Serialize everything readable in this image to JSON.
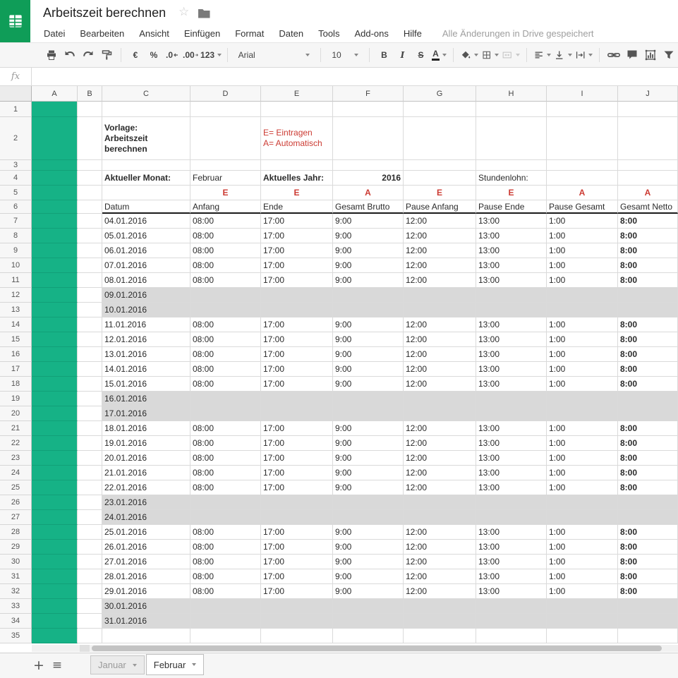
{
  "app": {
    "title": "Arbeitszeit berechnen",
    "menus": [
      "Datei",
      "Bearbeiten",
      "Ansicht",
      "Einfügen",
      "Format",
      "Daten",
      "Tools",
      "Add-ons",
      "Hilfe"
    ],
    "save_status": "Alle Änderungen in Drive gespeichert"
  },
  "toolbar": {
    "currency": "€",
    "percent": "%",
    "decrease_decimal": ".0",
    "increase_decimal": ".00",
    "number_format": "123",
    "font_name": "Arial",
    "font_size": "10",
    "bold": "B",
    "italic": "I",
    "strikethrough": "S",
    "text_color": "A"
  },
  "formula_bar": {
    "label": "fx",
    "value": ""
  },
  "sheet": {
    "columns": [
      "A",
      "B",
      "C",
      "D",
      "E",
      "F",
      "G",
      "H",
      "I",
      "J"
    ],
    "row_count": 35,
    "title_cell": "Vorlage:\nArbeitszeit\nberechnen",
    "legend": "E= Eintragen\nA= Automatisch",
    "info_row": {
      "label_month": "Aktueller Monat:",
      "month": "Februar",
      "label_year": "Aktuelles Jahr:",
      "year": "2016",
      "label_wage": "Stundenlohn:"
    },
    "flag_row": [
      "E",
      "E",
      "A",
      "E",
      "E",
      "A",
      "A"
    ],
    "headers": [
      "Datum",
      "Anfang",
      "Ende",
      "Gesamt Brutto",
      "Pause Anfang",
      "Pause Ende",
      "Pause Gesamt",
      "Gesamt Netto"
    ],
    "entries": [
      {
        "row": 7,
        "date": "04.01.2016",
        "weekend": false,
        "values": [
          "08:00",
          "17:00",
          "9:00",
          "12:00",
          "13:00",
          "1:00",
          "8:00"
        ]
      },
      {
        "row": 8,
        "date": "05.01.2016",
        "weekend": false,
        "values": [
          "08:00",
          "17:00",
          "9:00",
          "12:00",
          "13:00",
          "1:00",
          "8:00"
        ]
      },
      {
        "row": 9,
        "date": "06.01.2016",
        "weekend": false,
        "values": [
          "08:00",
          "17:00",
          "9:00",
          "12:00",
          "13:00",
          "1:00",
          "8:00"
        ]
      },
      {
        "row": 10,
        "date": "07.01.2016",
        "weekend": false,
        "values": [
          "08:00",
          "17:00",
          "9:00",
          "12:00",
          "13:00",
          "1:00",
          "8:00"
        ]
      },
      {
        "row": 11,
        "date": "08.01.2016",
        "weekend": false,
        "values": [
          "08:00",
          "17:00",
          "9:00",
          "12:00",
          "13:00",
          "1:00",
          "8:00"
        ]
      },
      {
        "row": 12,
        "date": "09.01.2016",
        "weekend": true
      },
      {
        "row": 13,
        "date": "10.01.2016",
        "weekend": true
      },
      {
        "row": 14,
        "date": "11.01.2016",
        "weekend": false,
        "values": [
          "08:00",
          "17:00",
          "9:00",
          "12:00",
          "13:00",
          "1:00",
          "8:00"
        ]
      },
      {
        "row": 15,
        "date": "12.01.2016",
        "weekend": false,
        "values": [
          "08:00",
          "17:00",
          "9:00",
          "12:00",
          "13:00",
          "1:00",
          "8:00"
        ]
      },
      {
        "row": 16,
        "date": "13.01.2016",
        "weekend": false,
        "values": [
          "08:00",
          "17:00",
          "9:00",
          "12:00",
          "13:00",
          "1:00",
          "8:00"
        ]
      },
      {
        "row": 17,
        "date": "14.01.2016",
        "weekend": false,
        "values": [
          "08:00",
          "17:00",
          "9:00",
          "12:00",
          "13:00",
          "1:00",
          "8:00"
        ]
      },
      {
        "row": 18,
        "date": "15.01.2016",
        "weekend": false,
        "values": [
          "08:00",
          "17:00",
          "9:00",
          "12:00",
          "13:00",
          "1:00",
          "8:00"
        ]
      },
      {
        "row": 19,
        "date": "16.01.2016",
        "weekend": true
      },
      {
        "row": 20,
        "date": "17.01.2016",
        "weekend": true
      },
      {
        "row": 21,
        "date": "18.01.2016",
        "weekend": false,
        "values": [
          "08:00",
          "17:00",
          "9:00",
          "12:00",
          "13:00",
          "1:00",
          "8:00"
        ]
      },
      {
        "row": 22,
        "date": "19.01.2016",
        "weekend": false,
        "values": [
          "08:00",
          "17:00",
          "9:00",
          "12:00",
          "13:00",
          "1:00",
          "8:00"
        ]
      },
      {
        "row": 23,
        "date": "20.01.2016",
        "weekend": false,
        "values": [
          "08:00",
          "17:00",
          "9:00",
          "12:00",
          "13:00",
          "1:00",
          "8:00"
        ]
      },
      {
        "row": 24,
        "date": "21.01.2016",
        "weekend": false,
        "values": [
          "08:00",
          "17:00",
          "9:00",
          "12:00",
          "13:00",
          "1:00",
          "8:00"
        ]
      },
      {
        "row": 25,
        "date": "22.01.2016",
        "weekend": false,
        "values": [
          "08:00",
          "17:00",
          "9:00",
          "12:00",
          "13:00",
          "1:00",
          "8:00"
        ]
      },
      {
        "row": 26,
        "date": "23.01.2016",
        "weekend": true
      },
      {
        "row": 27,
        "date": "24.01.2016",
        "weekend": true
      },
      {
        "row": 28,
        "date": "25.01.2016",
        "weekend": false,
        "values": [
          "08:00",
          "17:00",
          "9:00",
          "12:00",
          "13:00",
          "1:00",
          "8:00"
        ]
      },
      {
        "row": 29,
        "date": "26.01.2016",
        "weekend": false,
        "values": [
          "08:00",
          "17:00",
          "9:00",
          "12:00",
          "13:00",
          "1:00",
          "8:00"
        ]
      },
      {
        "row": 30,
        "date": "27.01.2016",
        "weekend": false,
        "values": [
          "08:00",
          "17:00",
          "9:00",
          "12:00",
          "13:00",
          "1:00",
          "8:00"
        ]
      },
      {
        "row": 31,
        "date": "28.01.2016",
        "weekend": false,
        "values": [
          "08:00",
          "17:00",
          "9:00",
          "12:00",
          "13:00",
          "1:00",
          "8:00"
        ]
      },
      {
        "row": 32,
        "date": "29.01.2016",
        "weekend": false,
        "values": [
          "08:00",
          "17:00",
          "9:00",
          "12:00",
          "13:00",
          "1:00",
          "8:00"
        ]
      },
      {
        "row": 33,
        "date": "30.01.2016",
        "weekend": true
      },
      {
        "row": 34,
        "date": "31.01.2016",
        "weekend": true
      }
    ]
  },
  "sheet_tabs": {
    "tabs": [
      {
        "label": "Januar",
        "active": false
      },
      {
        "label": "Februar",
        "active": true
      }
    ]
  },
  "colors": {
    "logo_green": "#0f9d58",
    "column_a_fill": "#16b286",
    "red_text": "#cc3b33",
    "weekend_gray": "#d9d9d9",
    "header_border": "#1a1a1a"
  }
}
